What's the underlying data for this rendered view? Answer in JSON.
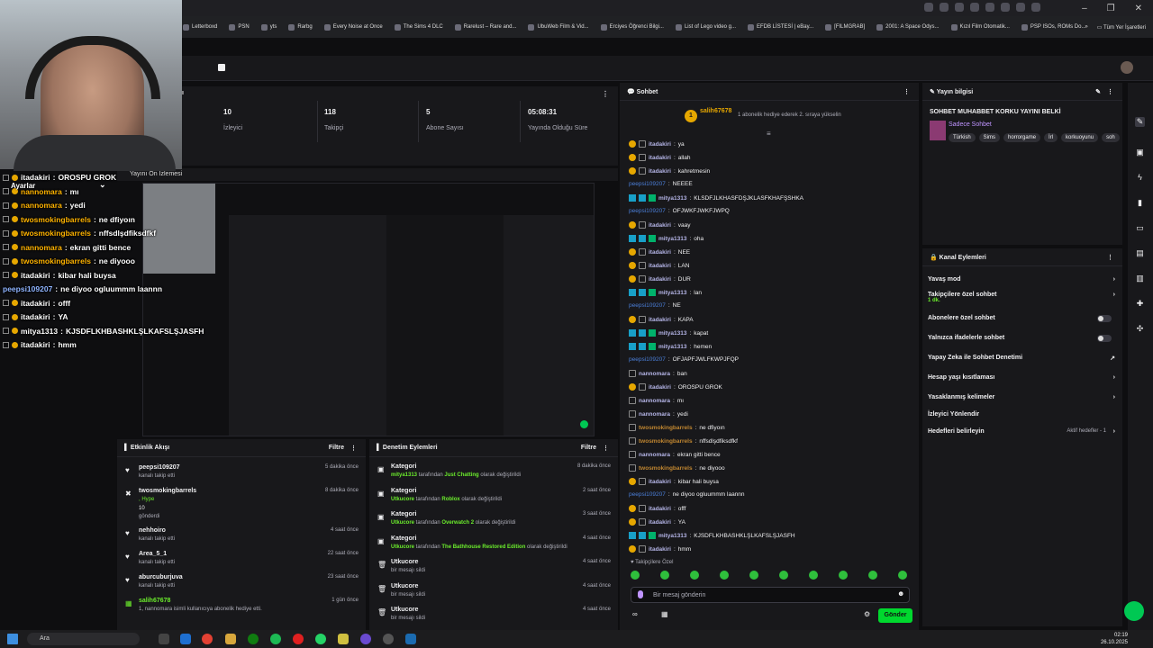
{
  "browser": {
    "bookmarks": [
      "Letterboxd",
      "PSN",
      "yts",
      "Rarbg",
      "Every Noise at Once",
      "The Sims 4 DLC",
      "Rarelust – Rare and...",
      "UbuWeb Film & Vid...",
      "Erciyes Öğrenci Bilgi...",
      "List of Lego video g...",
      "EFDB LİSTESİ | eBay...",
      "[FILMGRAB]",
      "2001: A Space Odys...",
      "Kızıl Film Otomatik...",
      "PSP ISOs, ROMs Do..."
    ],
    "all_bookmarks": "Tüm Yer İşaretleri"
  },
  "overlay": {
    "settings_label": "Ayarlar",
    "preview_label": "Yayını Ön İzlemesi",
    "lines": [
      {
        "user": "itadakiri",
        "text": "OROSPU GROK"
      },
      {
        "user": "nannomara",
        "text": "mı"
      },
      {
        "user": "nannomara",
        "text": "yedi"
      },
      {
        "user": "twosmokingbarrels",
        "text": "ne dfiyoın"
      },
      {
        "user": "twosmokingbarrels",
        "text": "nffsdlşdfiksdfkf"
      },
      {
        "user": "nannomara",
        "text": "ekran gitti bence"
      },
      {
        "user": "twosmokingbarrels",
        "text": "ne diyooo"
      },
      {
        "user": "itadakiri",
        "text": "kibar hali buysa"
      },
      {
        "user": "peepsi109207",
        "text": "ne diyoo ogluummm laannn"
      },
      {
        "user": "itadakiri",
        "text": "offf"
      },
      {
        "user": "itadakiri",
        "text": "YA"
      },
      {
        "user": "mitya1313",
        "text": "KJSDFLKHBASHKLŞLKAFSLŞJASFH"
      },
      {
        "user": "itadakiri",
        "text": "hmm"
      }
    ]
  },
  "stats": [
    {
      "value": "10",
      "label": "İzleyici"
    },
    {
      "value": "118",
      "label": "Takipçi"
    },
    {
      "value": "5",
      "label": "Abone Sayısı"
    },
    {
      "value": "05:08:31",
      "label": "Yayında Olduğu Süre"
    }
  ],
  "activity": {
    "title": "Etkinlik Akışı",
    "filter": "Filtre",
    "items": [
      {
        "user": "peepsi109207",
        "sub": "kanalı takip etti",
        "time": "5 dakika önce"
      },
      {
        "user": "twosmokingbarrels",
        "sub": ", Hype",
        "extra": "10",
        "extra2": "gönderdi",
        "time": "8 dakika önce"
      },
      {
        "user": "nehhoiro",
        "sub": "kanalı takip etti",
        "time": "4 saat önce"
      },
      {
        "user": "Area_5_1",
        "sub": "kanalı takip etti",
        "time": "22 saat önce"
      },
      {
        "user": "aburcuburjuva",
        "sub": "kanalı takip etti",
        "time": "23 saat önce"
      },
      {
        "user": "salih67678",
        "sub": "1, nannomara isimli kullanıcıya abonelik hediye etti.",
        "time": "1 gün önce"
      }
    ]
  },
  "moderation": {
    "title": "Denetim Eylemleri",
    "filter": "Filtre",
    "items": [
      {
        "head": "Kategori",
        "actor": "mitya1313",
        "mid": " tarafından ",
        "target": "Just Chatting",
        "tail": " olarak değiştirildi",
        "time": "8 dakika önce"
      },
      {
        "head": "Kategori",
        "actor": "Utkucore",
        "mid": " tarafından ",
        "target": "Roblox",
        "tail": " olarak değiştirildi",
        "time": "2 saat önce"
      },
      {
        "head": "Kategori",
        "actor": "Utkucore",
        "mid": " tarafından ",
        "target": "Overwatch 2",
        "tail": " olarak değiştirildi",
        "time": "3 saat önce"
      },
      {
        "head": "Kategori",
        "actor": "Utkucore",
        "mid": " tarafından ",
        "target": "The Bathhouse Restored Edition",
        "tail": " olarak değiştirildi",
        "time": "4 saat önce"
      },
      {
        "head": "Utkucore",
        "actor": "",
        "mid": "bir mesajı sildi",
        "target": "",
        "tail": "",
        "time": "4 saat önce"
      },
      {
        "head": "Utkucore",
        "actor": "",
        "mid": "bir mesajı sildi",
        "target": "",
        "tail": "",
        "time": "4 saat önce"
      },
      {
        "head": "Utkucore",
        "actor": "",
        "mid": "bir mesajı sildi",
        "target": "",
        "tail": "",
        "time": "4 saat önce"
      }
    ]
  },
  "chat": {
    "title": "Sohbet",
    "pinned_user": "salih67678",
    "pinned_text": "1 abonelik hediye ederek 2. sıraya yükselin",
    "messages": [
      {
        "u": "itadakiri",
        "t": "ya",
        "k": "it"
      },
      {
        "u": "itadakiri",
        "t": "allah",
        "k": "it"
      },
      {
        "u": "itadakiri",
        "t": "kahretmesin",
        "k": "it"
      },
      {
        "u": "peepsi109207",
        "t": "NEEEE",
        "k": "pe"
      },
      {
        "u": "mitya1313",
        "t": "KLSDFJLKHASFDŞJKLASFKHAFŞSHKA",
        "k": "mi"
      },
      {
        "u": "peepsi109207",
        "t": "OFJWKFJWKFJWPQ",
        "k": "pe"
      },
      {
        "u": "itadakiri",
        "t": "vaay",
        "k": "it"
      },
      {
        "u": "mitya1313",
        "t": "oha",
        "k": "mi"
      },
      {
        "u": "itadakiri",
        "t": "NEE",
        "k": "it"
      },
      {
        "u": "itadakiri",
        "t": "LAN",
        "k": "it"
      },
      {
        "u": "itadakiri",
        "t": "DUR",
        "k": "it"
      },
      {
        "u": "mitya1313",
        "t": "lan",
        "k": "mi"
      },
      {
        "u": "peepsi109207",
        "t": "NE",
        "k": "pe"
      },
      {
        "u": "itadakiri",
        "t": "KAPA",
        "k": "it"
      },
      {
        "u": "mitya1313",
        "t": "kapat",
        "k": "mi"
      },
      {
        "u": "mitya1313",
        "t": "hemen",
        "k": "mi"
      },
      {
        "u": "peepsi109207",
        "t": "OFJAPFJWLFKWPJFQP",
        "k": "pe"
      },
      {
        "u": "nannomara",
        "t": "ban",
        "k": "na"
      },
      {
        "u": "itadakiri",
        "t": "OROSPU GROK",
        "k": "it"
      },
      {
        "u": "nannomara",
        "t": "mı",
        "k": "na"
      },
      {
        "u": "nannomara",
        "t": "yedi",
        "k": "na"
      },
      {
        "u": "twosmokingbarrels",
        "t": "ne dfiyoın",
        "k": "tw"
      },
      {
        "u": "twosmokingbarrels",
        "t": "nffsdlşdfiksdfkf",
        "k": "tw"
      },
      {
        "u": "nannomara",
        "t": "ekran gitti bence",
        "k": "na"
      },
      {
        "u": "twosmokingbarrels",
        "t": "ne diyooo",
        "k": "tw"
      },
      {
        "u": "itadakiri",
        "t": "kibar hali buysa",
        "k": "it"
      },
      {
        "u": "peepsi109207",
        "t": "ne diyoo ogluummm laannn",
        "k": "pe"
      },
      {
        "u": "itadakiri",
        "t": "offf",
        "k": "it"
      },
      {
        "u": "itadakiri",
        "t": "YA",
        "k": "it"
      },
      {
        "u": "mitya1313",
        "t": "KJSDFLKHBASHKLŞLKAFSLŞJASFH",
        "k": "mi"
      },
      {
        "u": "itadakiri",
        "t": "hmm",
        "k": "it"
      }
    ],
    "followers_only": "Takipçilere Özel",
    "input_placeholder": "Bir mesaj gönderin",
    "send": "Gönder"
  },
  "stream_info": {
    "title": "Yayın bilgisi",
    "stream_title": "SOHBET MUHABBET KORKU YAYINI BELKİ",
    "category": "Sadece Sohbet",
    "tags": [
      "Türkish",
      "Sims",
      "horrorgame",
      "İrl",
      "korkuoyunu",
      "soh"
    ]
  },
  "channel_actions": {
    "title": "Kanal Eylemleri",
    "rows": [
      {
        "label": "Yavaş mod",
        "sub": "",
        "kind": "chev"
      },
      {
        "label": "Takipçilere özel sohbet",
        "sub": "1 dk.",
        "kind": "chev"
      },
      {
        "label": "Abonelere özel sohbet",
        "sub": "",
        "kind": "toggle"
      },
      {
        "label": "Yalnızca ifadelerle sohbet",
        "sub": "",
        "kind": "toggle"
      },
      {
        "label": "Yapay Zeka ile Sohbet Denetimi",
        "sub": "",
        "kind": "ext"
      },
      {
        "label": "Hesap yaşı kısıtlaması",
        "sub": "",
        "kind": "chev"
      },
      {
        "label": "Yasaklanmış kelimeler",
        "sub": "",
        "kind": "chev"
      },
      {
        "label": "İzleyici Yönlendir",
        "sub": "",
        "kind": "none"
      },
      {
        "label": "Hedefleri belirleyin",
        "sub": "Aktif hedefler - 1",
        "kind": "chev"
      }
    ]
  },
  "taskbar": {
    "search": "Ara",
    "time": "02:19",
    "date": "26.10.2025"
  }
}
